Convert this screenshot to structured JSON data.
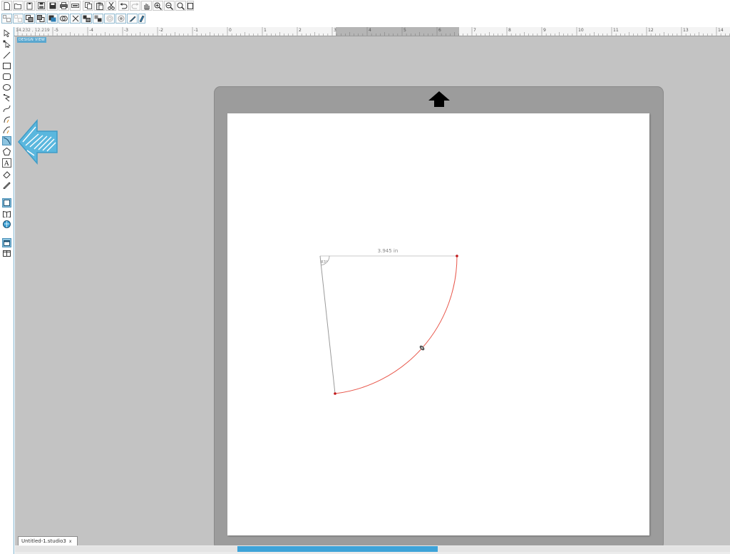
{
  "toolbar_top": {
    "buttons": [
      "new-document",
      "open",
      "save-template",
      "save",
      "save-as",
      "print",
      "send-to-cutter",
      "copy",
      "paste",
      "cut",
      "undo",
      "redo",
      "pan",
      "zoom-in",
      "zoom-out",
      "zoom-select",
      "zoom-drag",
      "fit-to-page"
    ]
  },
  "toolbar_secondary": {
    "buttons": [
      "group",
      "ungroup",
      "bring-front",
      "send-back",
      "weld",
      "delete",
      "duplicate",
      "mirror",
      "offset",
      "trace",
      "knife",
      "eraser"
    ]
  },
  "ruler": {
    "coords": "14.232 , 12.219",
    "labels": [
      "-5",
      "-4",
      "-3",
      "-2",
      "-1",
      "0",
      "1",
      "2",
      "3",
      "4",
      "5",
      "6",
      "7",
      "8",
      "9",
      "10",
      "11",
      "12",
      "13",
      "14"
    ]
  },
  "left_tools": [
    "select",
    "point-edit",
    "line",
    "rectangle",
    "rounded-rectangle",
    "ellipse",
    "polygon",
    "curve",
    "arc",
    "freehand",
    "smooth-freehand",
    "arc-selected",
    "regular-polygon",
    "text",
    "eraser",
    "knife",
    "page-view",
    "library",
    "store",
    "design-view",
    "split-view"
  ],
  "canvas": {
    "design_view_label": "DESIGN VIEW",
    "dimension_label": "3.945 in",
    "angle_label": "83°",
    "arc_color": "#e8564a",
    "point_color": "#c0181b"
  },
  "document_tab": {
    "label": "Untitled-1.studio3",
    "close": "x"
  },
  "colors": {
    "canvas_bg": "#c3c3c3",
    "mat": "#9c9c9c",
    "accent": "#3ea3d8",
    "hint_arrow": "#5ab7de"
  }
}
